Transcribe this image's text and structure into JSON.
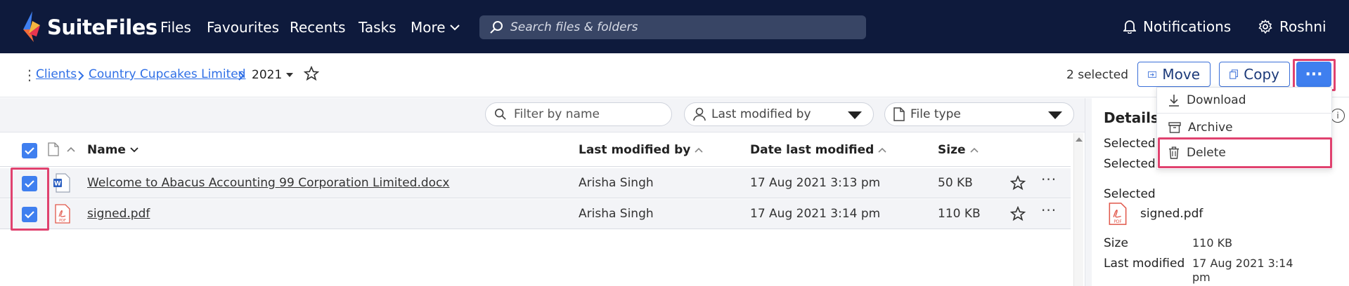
{
  "header": {
    "brand": "SuiteFiles",
    "nav": [
      "Files",
      "Favourites",
      "Recents",
      "Tasks"
    ],
    "more_label": "More",
    "search_placeholder": "Search files & folders",
    "notifications_label": "Notifications",
    "user_name": "Roshni"
  },
  "breadcrumb": {
    "items": [
      "Clients",
      "Country Cupcakes Limited"
    ],
    "separator": ">",
    "current": "2021"
  },
  "selection": {
    "count_label": "2 selected",
    "move_label": "Move",
    "copy_label": "Copy",
    "more_label": "···"
  },
  "more_menu": {
    "items": [
      {
        "label": "Download",
        "icon": "download-icon"
      },
      {
        "label": "Archive",
        "icon": "archive-icon"
      },
      {
        "label": "Delete",
        "icon": "trash-icon"
      }
    ]
  },
  "filters": {
    "name_placeholder": "Filter by name",
    "modified_by_label": "Last modified by",
    "file_type_label": "File type"
  },
  "table": {
    "columns": [
      "Name",
      "Last modified by",
      "Date last modified",
      "Size"
    ],
    "rows": [
      {
        "name": "Welcome to Abacus Accounting 99 Corporation Limited.docx",
        "type": "word",
        "modified_by": "Arisha Singh",
        "date": "17 Aug 2021 3:13 pm",
        "size": "50 KB"
      },
      {
        "name": "signed.pdf",
        "type": "pdf",
        "modified_by": "Arisha Singh",
        "date": "17 Aug 2021 3:14 pm",
        "size": "110 KB"
      }
    ]
  },
  "details": {
    "title": "Details",
    "selected_label_1": "Selected",
    "selected_label_2": "Selected",
    "selected_label_3": "Selected",
    "selected_file": "signed.pdf",
    "size_label": "Size",
    "size_value": "110 KB",
    "last_modified_label": "Last modified",
    "last_modified_value_1": "17 Aug 2021 3:14",
    "last_modified_value_2": "pm"
  },
  "colors": {
    "header_bg": "#0e1a3c",
    "accent": "#3f7fef",
    "highlight": "#e0426f",
    "link": "#2f6fe6"
  }
}
